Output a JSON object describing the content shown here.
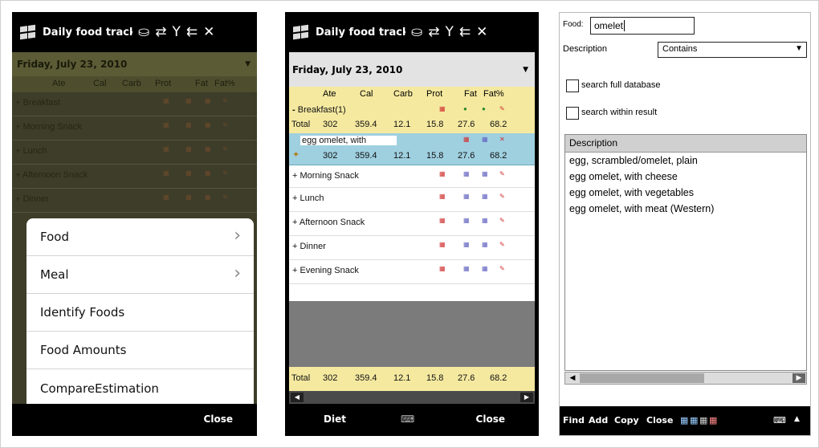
{
  "phone1": {
    "title": "Daily food track",
    "status_icons": [
      "⛀",
      "⇄",
      "Y",
      "⇇",
      "✕"
    ],
    "date": "Friday, July 23, 2010",
    "columns": [
      "Ate",
      "Cal",
      "Carb",
      "Prot",
      "Fat",
      "Fat%"
    ],
    "meals": [
      "Breakfast",
      "Morning Snack",
      "Lunch",
      "Afternoon Snack",
      "Dinner"
    ],
    "menu": [
      {
        "label": "Food",
        "arrow": "›"
      },
      {
        "label": "Meal",
        "arrow": "›"
      },
      {
        "label": "Identify Foods",
        "arrow": ""
      },
      {
        "label": "Food Amounts",
        "arrow": ""
      },
      {
        "label": "CompareEstimation",
        "arrow": ""
      }
    ],
    "softkey_right": "Close"
  },
  "phone2": {
    "title": "Daily food track",
    "date": "Friday, July 23, 2010",
    "columns": [
      "Ate",
      "Cal",
      "Carb",
      "Prot",
      "Fat",
      "Fat%"
    ],
    "breakfast": {
      "label": "Breakfast(1)",
      "prefix": "-"
    },
    "total_label": "Total",
    "breakfast_total": [
      "302",
      "359.4",
      "12.1",
      "15.8",
      "27.6",
      "68.2"
    ],
    "selected_item": {
      "name": "egg omelet, with",
      "values": [
        "302",
        "359.4",
        "12.1",
        "15.8",
        "27.6",
        "68.2"
      ]
    },
    "meals": [
      "Morning Snack",
      "Lunch",
      "Afternoon Snack",
      "Dinner",
      "Evening Snack"
    ],
    "grand_total": [
      "302",
      "359.4",
      "12.1",
      "15.8",
      "27.6",
      "68.2"
    ],
    "softkey_left": "Diet",
    "softkey_right": "Close"
  },
  "phone3": {
    "food_label": "Food:",
    "food_value": "omelet",
    "description_label": "Description",
    "match_mode": "Contains",
    "search_full": "search full database",
    "search_within": "search within result",
    "list_header": "Description",
    "results": [
      "egg, scrambled/omelet, plain",
      "egg omelet, with cheese",
      "egg omelet, with vegetables",
      "egg omelet, with meat (Western)"
    ],
    "menu": [
      "Find",
      "Add",
      "Copy",
      "Close"
    ]
  }
}
